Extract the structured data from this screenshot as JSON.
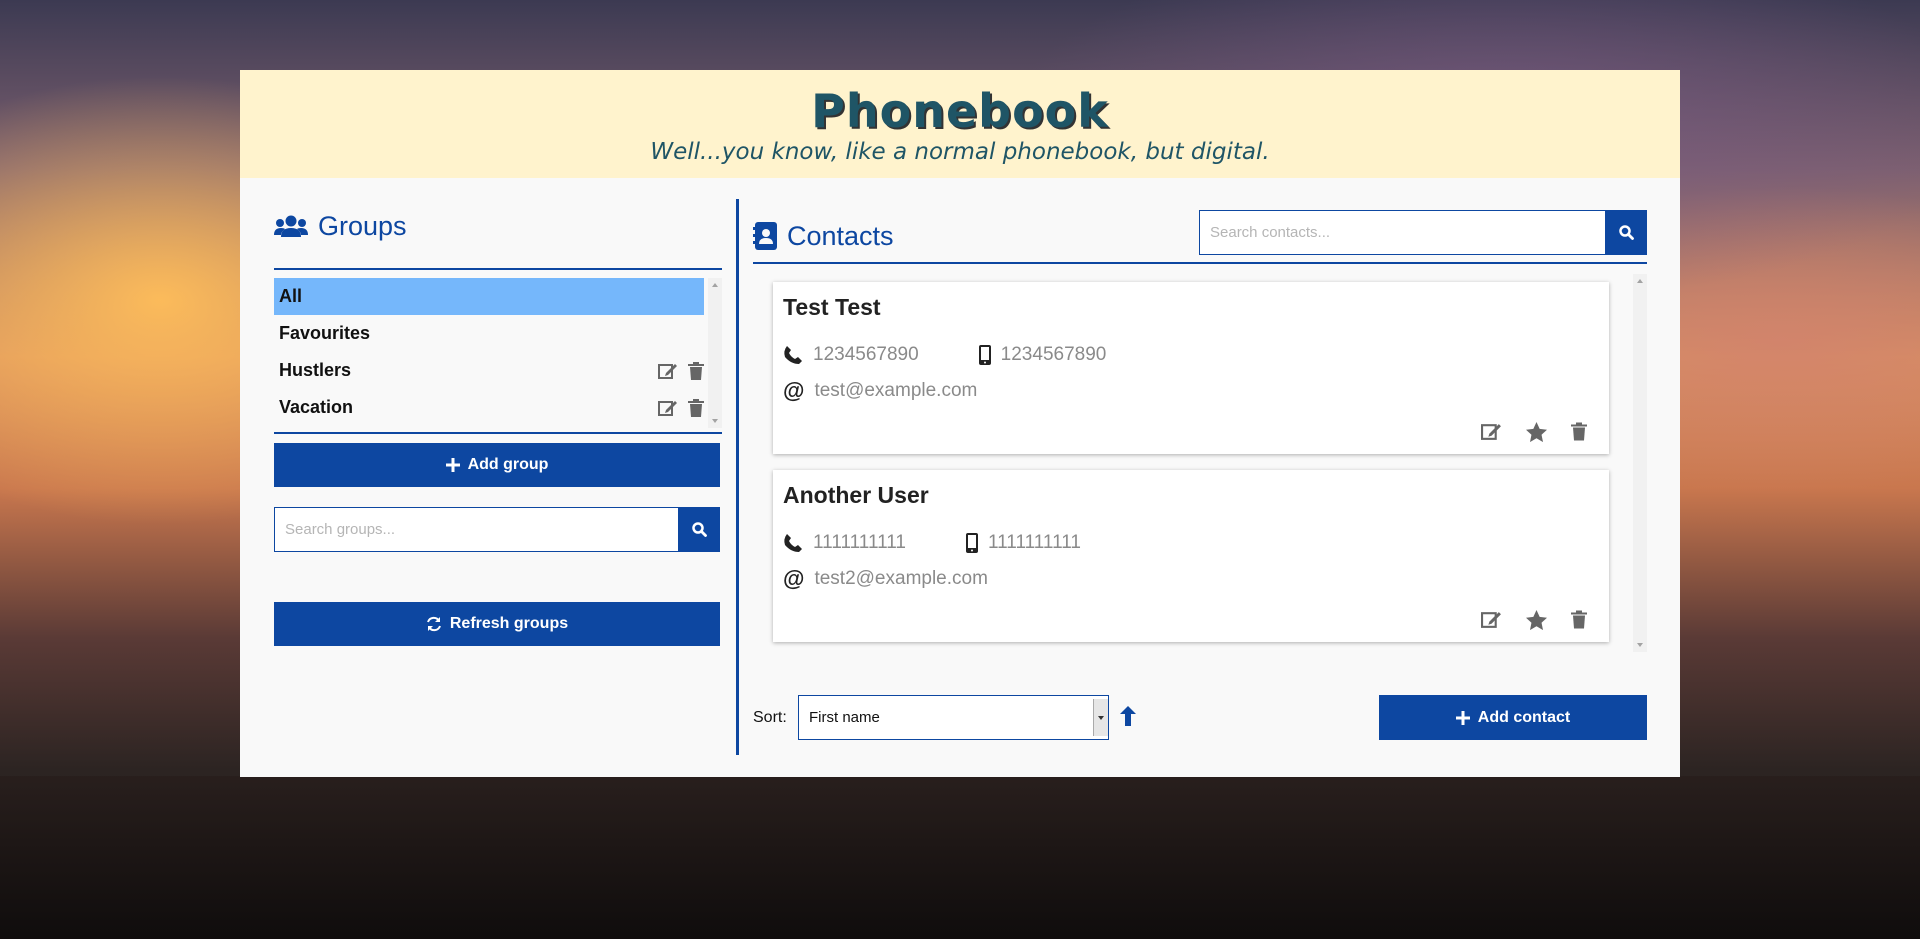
{
  "header": {
    "title": "Phonebook",
    "subtitle": "Well...you know, like a normal phonebook, but digital."
  },
  "groups": {
    "title": "Groups",
    "items": [
      {
        "label": "All",
        "active": true,
        "editable": false
      },
      {
        "label": "Favourites",
        "active": false,
        "editable": false
      },
      {
        "label": "Hustlers",
        "active": false,
        "editable": true
      },
      {
        "label": "Vacation",
        "active": false,
        "editable": true
      }
    ],
    "add_label": "Add group",
    "search_placeholder": "Search groups...",
    "refresh_label": "Refresh groups"
  },
  "contacts": {
    "title": "Contacts",
    "search_placeholder": "Search contacts...",
    "items": [
      {
        "name": "Test Test",
        "phone": "1234567890",
        "mobile": "1234567890",
        "email": "test@example.com"
      },
      {
        "name": "Another User",
        "phone": "1111111111",
        "mobile": "1111111111",
        "email": "test2@example.com"
      }
    ],
    "sort_label": "Sort:",
    "sort_value": "First name",
    "sort_direction": "ascending",
    "add_label": "Add contact"
  },
  "colors": {
    "accent": "#0d47a1",
    "active_group": "#75b7fb",
    "header_bg": "#fff3cd",
    "title_color": "#1f5566"
  }
}
